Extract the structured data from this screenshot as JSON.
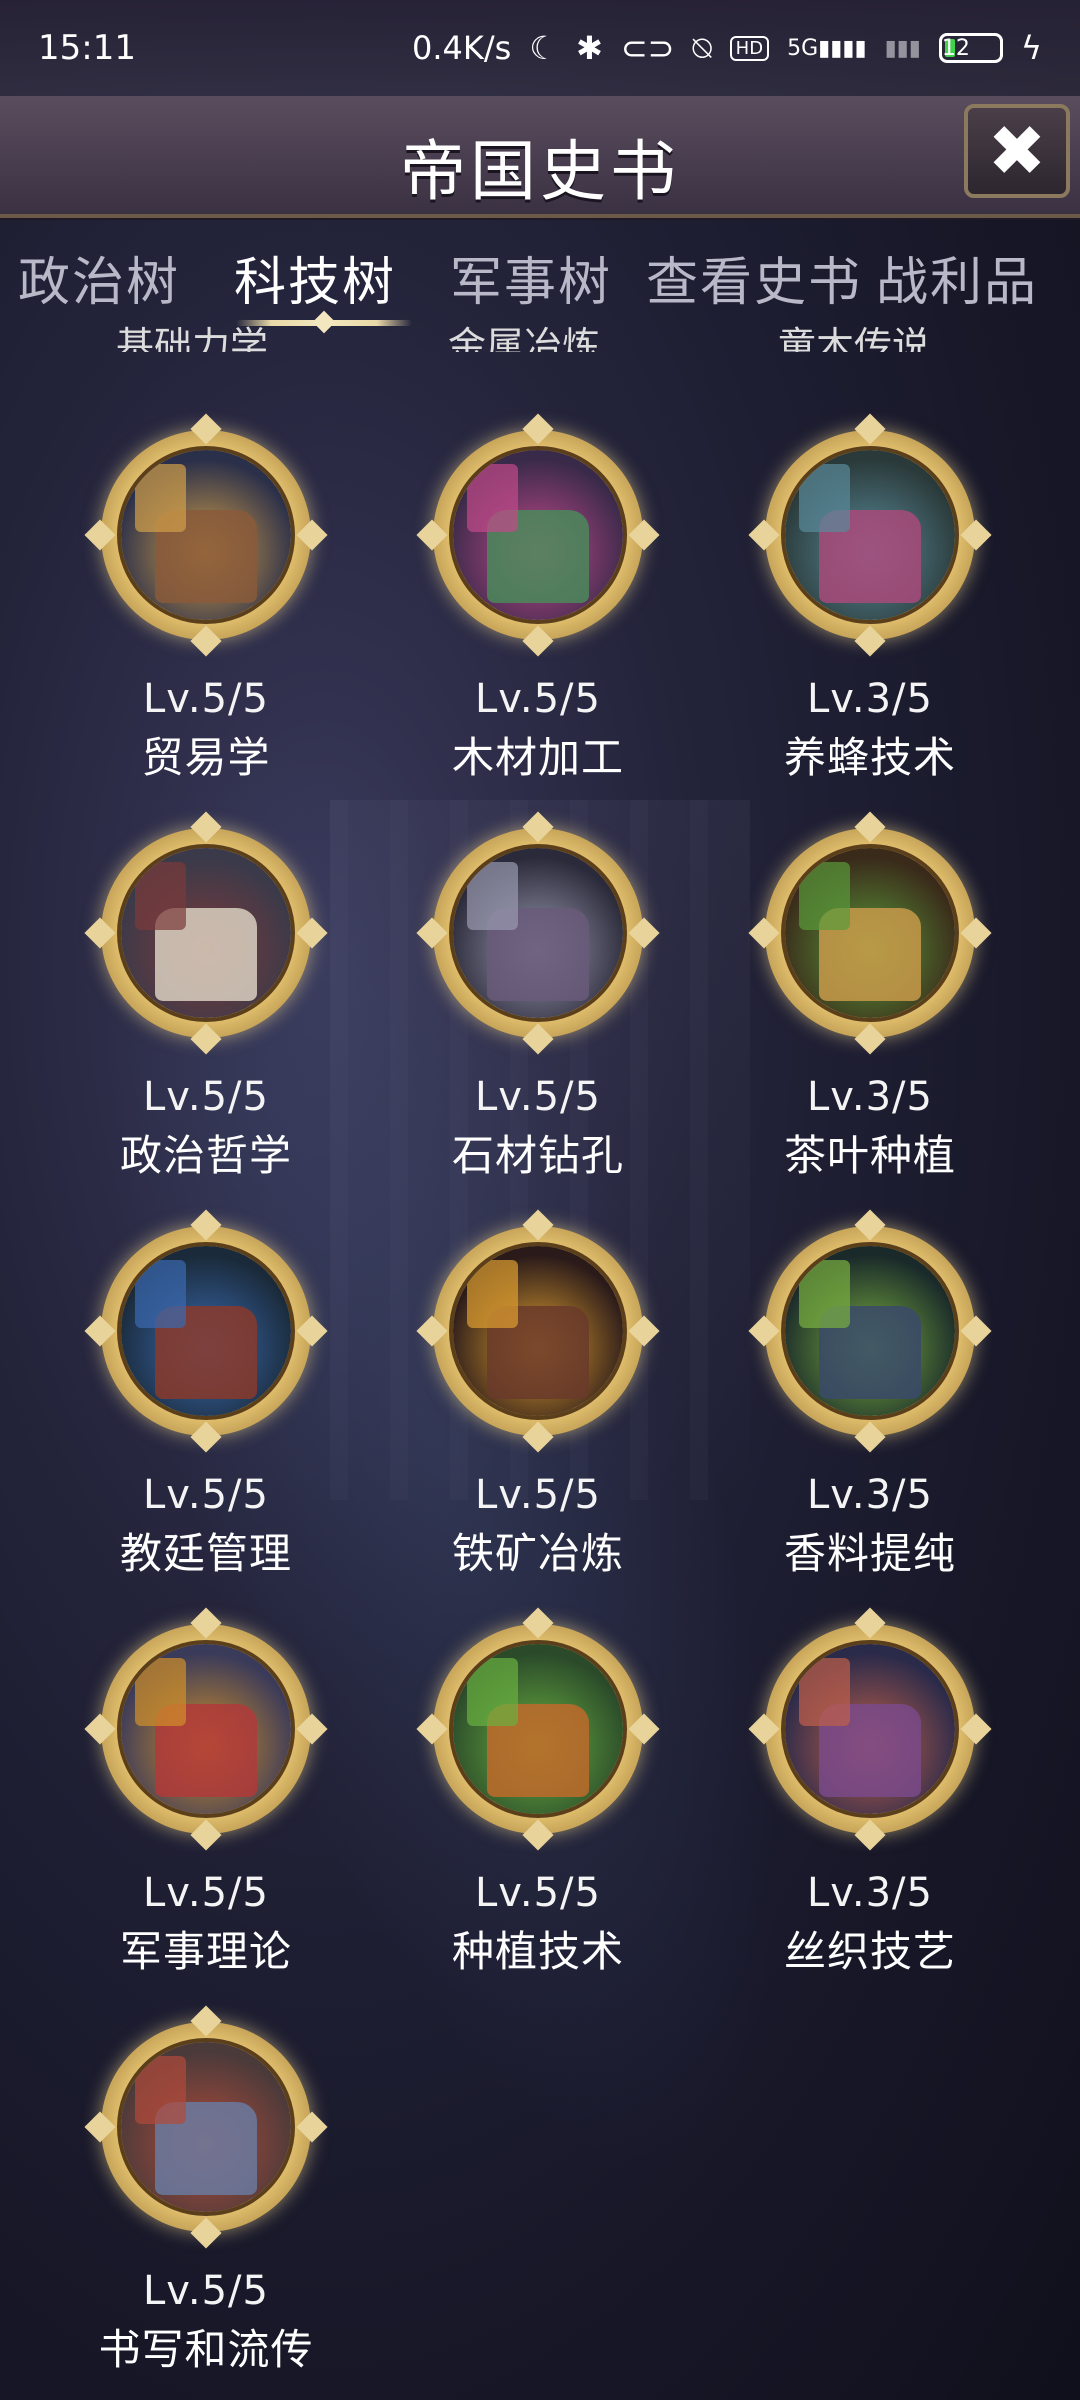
{
  "status_bar": {
    "time": "15:11",
    "net_speed": "0.4K/s",
    "moon_icon": "☾",
    "bluetooth_icon": "✱",
    "link_icon": "⊂⊃",
    "mute_icon": "⍉",
    "hd": "HD",
    "signal": "5G▮▮▮▮",
    "signal2": "▮▮▮",
    "battery": "12",
    "charging_icon": "ϟ"
  },
  "header": {
    "title": "帝国史书",
    "close_symbol": "✖"
  },
  "tabs": [
    {
      "label": "政治树"
    },
    {
      "label": "科技树"
    },
    {
      "label": "军事树"
    },
    {
      "label": "查看史书"
    },
    {
      "label": "战利品"
    }
  ],
  "active_tab": "科技树",
  "partial_row": [
    "基础力学",
    "金属冶炼",
    "童木传说"
  ],
  "skills": [
    {
      "level": "Lv.5/5",
      "name": "贸易学",
      "colors": [
        "#2a2f4a",
        "#d2a04a",
        "#8a5a3a"
      ]
    },
    {
      "level": "Lv.5/5",
      "name": "木材加工",
      "colors": [
        "#3a2a4a",
        "#c24a8a",
        "#4a8a5a"
      ]
    },
    {
      "level": "Lv.3/5",
      "name": "养蜂技术",
      "colors": [
        "#2a3a3a",
        "#5a8a9a",
        "#a84a7a"
      ]
    },
    {
      "level": "Lv.5/5",
      "name": "政治哲学",
      "colors": [
        "#3a3a4a",
        "#7a3a3a",
        "#d9d0c0"
      ]
    },
    {
      "level": "Lv.5/5",
      "name": "石材钻孔",
      "colors": [
        "#2a2a3a",
        "#9a9ab0",
        "#6a5a7a"
      ]
    },
    {
      "level": "Lv.3/5",
      "name": "茶叶种植",
      "colors": [
        "#3a2a1a",
        "#5a9a3a",
        "#c89a4a"
      ]
    },
    {
      "level": "Lv.5/5",
      "name": "教廷管理",
      "colors": [
        "#1a2a3a",
        "#3a6ab0",
        "#8a3a2a"
      ]
    },
    {
      "level": "Lv.5/5",
      "name": "铁矿冶炼",
      "colors": [
        "#2a1a1a",
        "#e0a030",
        "#6a3a2a"
      ]
    },
    {
      "level": "Lv.3/5",
      "name": "香料提纯",
      "colors": [
        "#1a2a2a",
        "#7ab040",
        "#3a4a6a"
      ]
    },
    {
      "level": "Lv.5/5",
      "name": "军事理论",
      "colors": [
        "#3a3a5a",
        "#d0902a",
        "#b03a3a"
      ]
    },
    {
      "level": "Lv.5/5",
      "name": "种植技术",
      "colors": [
        "#2a4a2a",
        "#6ab040",
        "#c06a2a"
      ]
    },
    {
      "level": "Lv.3/5",
      "name": "丝织技艺",
      "colors": [
        "#2a2a4a",
        "#c0604a",
        "#7a4a8a"
      ]
    },
    {
      "level": "Lv.5/5",
      "name": "书写和流传",
      "colors": [
        "#4a3a3a",
        "#b04a3a",
        "#6a7aa0"
      ]
    }
  ]
}
